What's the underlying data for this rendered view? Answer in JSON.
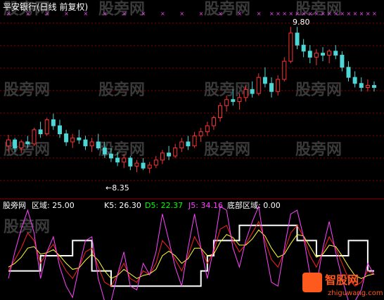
{
  "app": {
    "title": "平安银行(日线 前复权)",
    "watermarks": [
      "股旁网",
      "股旁网",
      "股旁网",
      "股旁网",
      "股旁网",
      "股旁网",
      "股旁网",
      "股旁网",
      "股旁网",
      "股旁网",
      "股旁网",
      "股旁网",
      "股旁网"
    ],
    "logo_text": "智股网",
    "logo_url": "zhiguwang.com"
  },
  "colors": {
    "background": "#000000",
    "up_candle": "#ff3333",
    "down_candle": "#4fd6d6",
    "grid": "#8b0000",
    "magenta_marks": "#ff44ff",
    "white_line": "#ffffff",
    "k_line": "#ff2222",
    "d_line": "#ffff33",
    "j_line": "#ff44ff",
    "text_white": "#ffffff",
    "text_k": "#ffffff",
    "text_d": "#00ff00",
    "text_j": "#ff44ff"
  },
  "chart_data": [
    {
      "type": "candlestick",
      "title": "平安银行(日线 前复权)",
      "annotations": [
        {
          "text": "9.80",
          "kind": "high"
        },
        {
          "text": "←8.35",
          "kind": "low"
        }
      ],
      "ylim": [
        8.2,
        9.9
      ],
      "candles": [
        [
          8.62,
          8.73,
          8.56,
          8.68
        ],
        [
          8.68,
          8.7,
          8.56,
          8.6
        ],
        [
          8.6,
          8.68,
          8.55,
          8.66
        ],
        [
          8.66,
          8.72,
          8.6,
          8.64
        ],
        [
          8.64,
          8.8,
          8.62,
          8.78
        ],
        [
          8.78,
          8.86,
          8.7,
          8.74
        ],
        [
          8.74,
          8.9,
          8.72,
          8.88
        ],
        [
          8.88,
          8.94,
          8.78,
          8.82
        ],
        [
          8.82,
          8.88,
          8.7,
          8.74
        ],
        [
          8.74,
          8.78,
          8.62,
          8.66
        ],
        [
          8.66,
          8.74,
          8.6,
          8.7
        ],
        [
          8.7,
          8.78,
          8.64,
          8.68
        ],
        [
          8.68,
          8.72,
          8.58,
          8.62
        ],
        [
          8.62,
          8.7,
          8.56,
          8.66
        ],
        [
          8.66,
          8.74,
          8.58,
          8.6
        ],
        [
          8.6,
          8.66,
          8.5,
          8.54
        ],
        [
          8.54,
          8.6,
          8.46,
          8.5
        ],
        [
          8.5,
          8.56,
          8.42,
          8.46
        ],
        [
          8.46,
          8.54,
          8.4,
          8.5
        ],
        [
          8.5,
          8.52,
          8.38,
          8.42
        ],
        [
          8.42,
          8.48,
          8.36,
          8.45
        ],
        [
          8.45,
          8.5,
          8.38,
          8.4
        ],
        [
          8.4,
          8.46,
          8.35,
          8.43
        ],
        [
          8.43,
          8.52,
          8.4,
          8.48
        ],
        [
          8.48,
          8.58,
          8.44,
          8.55
        ],
        [
          8.55,
          8.62,
          8.48,
          8.52
        ],
        [
          8.52,
          8.64,
          8.5,
          8.6
        ],
        [
          8.6,
          8.7,
          8.56,
          8.66
        ],
        [
          8.66,
          8.72,
          8.58,
          8.62
        ],
        [
          8.62,
          8.76,
          8.6,
          8.72
        ],
        [
          8.72,
          8.8,
          8.66,
          8.76
        ],
        [
          8.76,
          8.86,
          8.72,
          8.82
        ],
        [
          8.82,
          8.92,
          8.78,
          8.9
        ],
        [
          8.9,
          9.05,
          8.86,
          9.02
        ],
        [
          9.02,
          9.12,
          8.96,
          9.08
        ],
        [
          9.08,
          9.18,
          9.02,
          9.06
        ],
        [
          9.06,
          9.14,
          8.98,
          9.1
        ],
        [
          9.1,
          9.22,
          9.06,
          9.18
        ],
        [
          9.18,
          9.26,
          9.1,
          9.14
        ],
        [
          9.14,
          9.34,
          9.12,
          9.3
        ],
        [
          9.3,
          9.4,
          9.2,
          9.24
        ],
        [
          9.24,
          9.3,
          9.1,
          9.16
        ],
        [
          9.16,
          9.32,
          9.12,
          9.28
        ],
        [
          9.28,
          9.5,
          9.26,
          9.46
        ],
        [
          9.46,
          9.8,
          9.44,
          9.74
        ],
        [
          9.74,
          9.8,
          9.58,
          9.62
        ],
        [
          9.62,
          9.68,
          9.5,
          9.56
        ],
        [
          9.56,
          9.62,
          9.44,
          9.5
        ],
        [
          9.5,
          9.58,
          9.42,
          9.54
        ],
        [
          9.54,
          9.6,
          9.46,
          9.52
        ],
        [
          9.52,
          9.58,
          9.44,
          9.56
        ],
        [
          9.56,
          9.62,
          9.48,
          9.52
        ],
        [
          9.52,
          9.56,
          9.36,
          9.4
        ],
        [
          9.4,
          9.46,
          9.26,
          9.3
        ],
        [
          9.3,
          9.36,
          9.2,
          9.24
        ],
        [
          9.24,
          9.3,
          9.16,
          9.2
        ],
        [
          9.2,
          9.28,
          9.16,
          9.22
        ],
        [
          9.22,
          9.26,
          9.16,
          9.2
        ]
      ]
    },
    {
      "type": "line",
      "labels": {
        "name": "股旁网",
        "zone": "区域: 25.00",
        "k": "K5: 26.30",
        "d": "D5: 22.37",
        "j": "J5: 34.16",
        "bottom": "底部区域: 0.00"
      },
      "ylim": [
        0,
        100
      ],
      "series": [
        {
          "name": "区域",
          "values": [
            30,
            30,
            30,
            30,
            30,
            50,
            50,
            50,
            50,
            50,
            70,
            70,
            70,
            30,
            30,
            30,
            10,
            10,
            10,
            10,
            10,
            10,
            10,
            10,
            10,
            10,
            10,
            10,
            10,
            10,
            30,
            50,
            70,
            70,
            70,
            70,
            90,
            90,
            90,
            90,
            90,
            90,
            90,
            90,
            90,
            70,
            70,
            70,
            50,
            50,
            50,
            50,
            50,
            70,
            70,
            70,
            30,
            30
          ]
        },
        {
          "name": "K5",
          "values": [
            30,
            45,
            60,
            80,
            70,
            40,
            55,
            65,
            45,
            30,
            20,
            35,
            55,
            60,
            35,
            15,
            10,
            25,
            40,
            20,
            15,
            30,
            25,
            40,
            70,
            60,
            45,
            30,
            50,
            75,
            60,
            40,
            55,
            85,
            90,
            70,
            55,
            65,
            80,
            95,
            70,
            45,
            35,
            55,
            80,
            90,
            75,
            50,
            35,
            55,
            75,
            60,
            40,
            20,
            10,
            15,
            30,
            25
          ]
        },
        {
          "name": "D5",
          "values": [
            35,
            40,
            48,
            60,
            62,
            52,
            54,
            58,
            50,
            40,
            32,
            34,
            44,
            52,
            44,
            30,
            20,
            24,
            32,
            26,
            20,
            24,
            26,
            32,
            50,
            56,
            50,
            40,
            46,
            60,
            60,
            50,
            52,
            68,
            78,
            74,
            64,
            64,
            72,
            84,
            76,
            60,
            48,
            52,
            66,
            78,
            76,
            62,
            48,
            52,
            64,
            62,
            50,
            36,
            24,
            20,
            24,
            26
          ]
        },
        {
          "name": "J5",
          "values": [
            20,
            55,
            85,
            110,
            80,
            20,
            55,
            75,
            35,
            10,
            -5,
            35,
            70,
            75,
            20,
            -10,
            -10,
            25,
            55,
            10,
            5,
            40,
            25,
            55,
            105,
            70,
            35,
            10,
            60,
            105,
            60,
            20,
            60,
            115,
            110,
            60,
            35,
            70,
            95,
            115,
            60,
            15,
            10,
            60,
            105,
            110,
            75,
            25,
            10,
            60,
            95,
            55,
            20,
            -10,
            -20,
            5,
            40,
            25
          ]
        }
      ]
    }
  ]
}
